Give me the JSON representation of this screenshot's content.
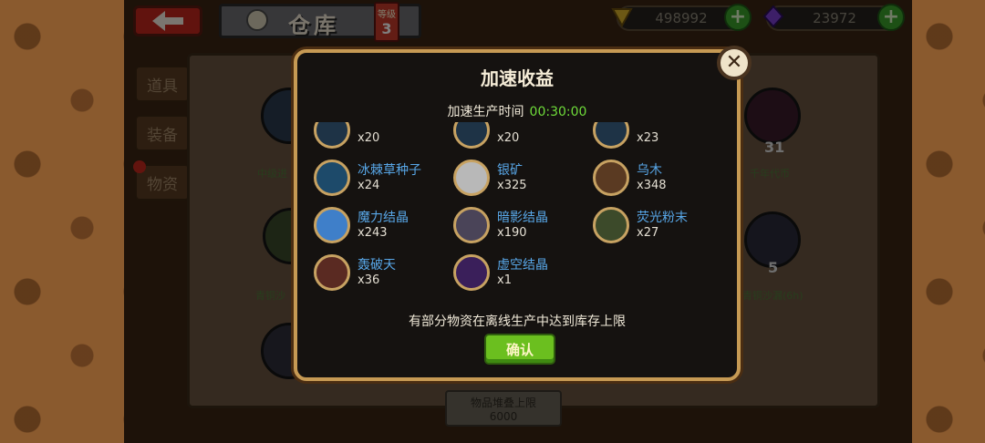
{
  "header": {
    "title": "仓库",
    "level_label": "等级",
    "level_value": "3",
    "gold": "498992",
    "gems": "23972",
    "plus": "+"
  },
  "tabs": [
    {
      "label": "道具"
    },
    {
      "label": "装备"
    },
    {
      "label": "物资"
    }
  ],
  "background_items": {
    "labels": [
      "中级进",
      "千年代币",
      "青铜沙",
      "青铜沙漏(6h)"
    ],
    "numbers": [
      "31",
      "5"
    ],
    "stack_limit_label": "物品堆叠上限",
    "stack_limit_value": "6000"
  },
  "modal": {
    "title": "加速收益",
    "time_label": "加速生产时间",
    "time_value": "00:30:00",
    "note": "有部分物资在离线生产中达到库存上限",
    "confirm": "确认",
    "resources": [
      {
        "name": "",
        "qty": "x20"
      },
      {
        "name": "",
        "qty": "x20"
      },
      {
        "name": "",
        "qty": "x23"
      },
      {
        "name": "冰棘草种子",
        "qty": "x24"
      },
      {
        "name": "银矿",
        "qty": "x325"
      },
      {
        "name": "乌木",
        "qty": "x348"
      },
      {
        "name": "魔力结晶",
        "qty": "x243"
      },
      {
        "name": "暗影结晶",
        "qty": "x190"
      },
      {
        "name": "荧光粉末",
        "qty": "x27"
      },
      {
        "name": "轰破天",
        "qty": "x36"
      },
      {
        "name": "虚空结晶",
        "qty": "x1"
      }
    ]
  },
  "colors": {
    "accent_green": "#6fdc3a",
    "resource_name_blue": "#58a7e8",
    "modal_border": "#c69a54"
  }
}
